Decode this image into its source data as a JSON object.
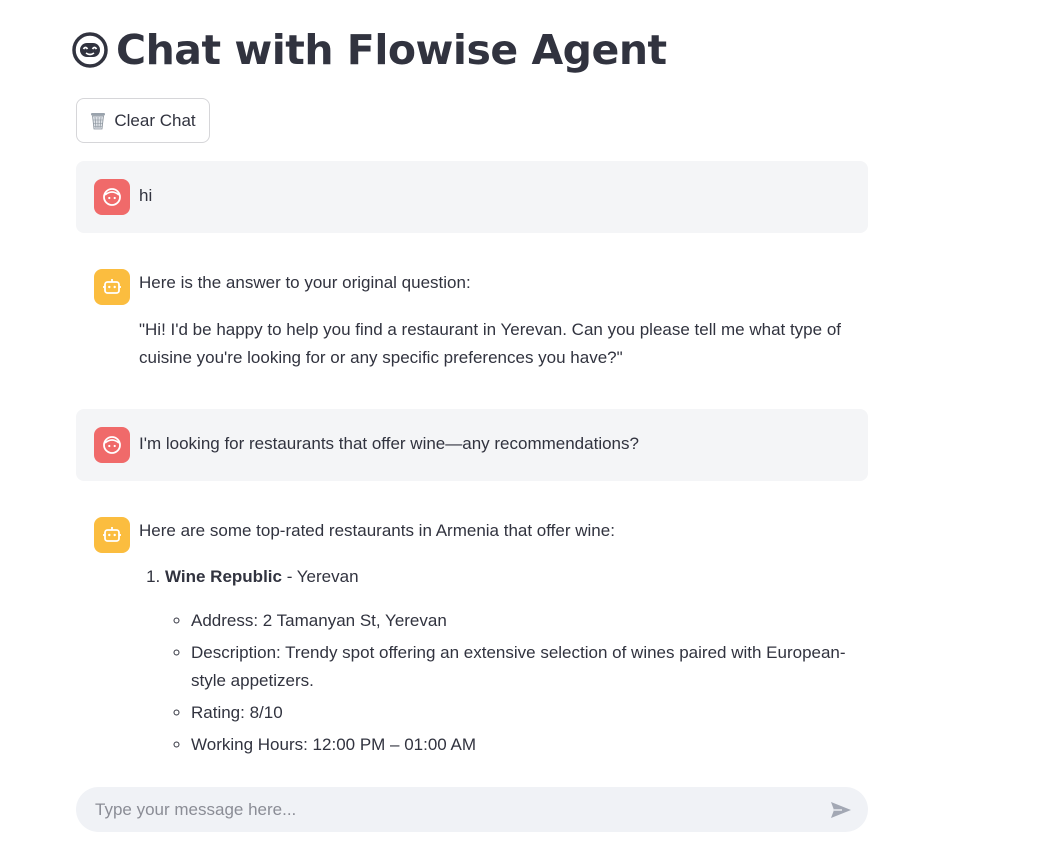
{
  "header": {
    "title": "Chat with Flowise Agent",
    "icon": "robot-face-icon"
  },
  "toolbar": {
    "clear_label": "Clear Chat",
    "clear_icon": "wastebasket-icon"
  },
  "messages": [
    {
      "role": "user",
      "text": "hi"
    },
    {
      "role": "assistant",
      "intro": "Here is the answer to your original question:",
      "body": "\"Hi! I'd be happy to help you find a restaurant in Yerevan. Can you please tell me what type of cuisine you're looking for or any specific preferences you have?\""
    },
    {
      "role": "user",
      "text": "I'm looking for restaurants that offer wine—any recommendations?"
    },
    {
      "role": "assistant",
      "intro": "Here are some top-rated restaurants in Armenia that offer wine:",
      "list": [
        {
          "name": "Wine Republic",
          "suffix": " - Yerevan",
          "details": [
            "Address: 2 Tamanyan St, Yerevan",
            "Description: Trendy spot offering an extensive selection of wines paired with European-style appetizers.",
            "Rating: 8/10",
            "Working Hours: 12:00 PM – 01:00 AM"
          ]
        }
      ]
    }
  ],
  "input": {
    "placeholder": "Type your message here...",
    "value": "",
    "send_icon": "send-icon"
  },
  "colors": {
    "user_avatar": "#f06a6a",
    "bot_avatar": "#fbbd3f",
    "user_bubble": "#f4f5f7",
    "input_bg": "#f0f2f6",
    "text": "#31333f"
  }
}
